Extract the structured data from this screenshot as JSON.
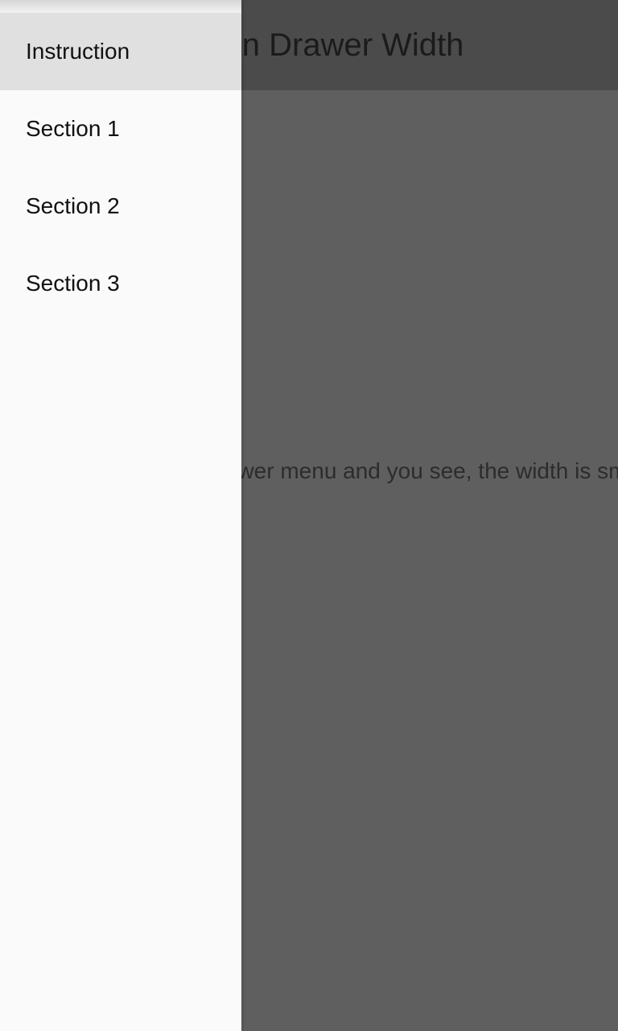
{
  "app_bar": {
    "title": "Navigation Drawer Width"
  },
  "content": {
    "message": "Open the drawer menu and you see, the width is smaller."
  },
  "drawer": {
    "items": [
      {
        "label": "Instruction",
        "selected": true
      },
      {
        "label": "Section 1",
        "selected": false
      },
      {
        "label": "Section 2",
        "selected": false
      },
      {
        "label": "Section 3",
        "selected": false
      }
    ]
  },
  "colors": {
    "scrim_background": "#5f5f5f",
    "app_bar_dimmed": "#4b4b4b",
    "drawer_background": "#fafafa",
    "selected_item": "#e0e0e0"
  }
}
